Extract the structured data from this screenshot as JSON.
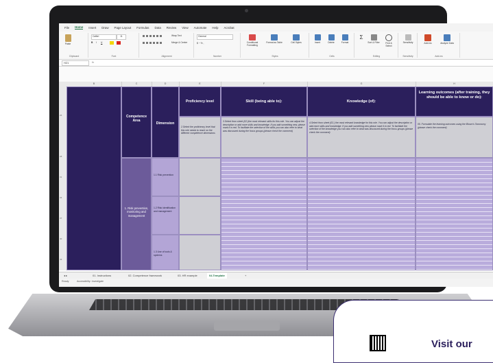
{
  "menu": [
    "File",
    "Home",
    "Insert",
    "Draw",
    "Page Layout",
    "Formulas",
    "Data",
    "Review",
    "View",
    "Automate",
    "Help",
    "Acrobat"
  ],
  "active_menu": "Home",
  "ribbon": {
    "clipboard": {
      "paste": "Paste",
      "label": "Clipboard"
    },
    "font": {
      "name": "Calibri",
      "size": "11",
      "label": "Font"
    },
    "alignment": {
      "wrap": "Wrap Text",
      "merge": "Merge & Center",
      "label": "Alignment"
    },
    "number": {
      "format": "General",
      "label": "Number"
    },
    "styles": {
      "conditional": "Conditional Formatting",
      "format_table": "Format as Table",
      "cell_styles": "Cell Styles",
      "label": "Styles"
    },
    "cells": {
      "insert": "Insert",
      "delete": "Delete",
      "format": "Format",
      "label": "Cells"
    },
    "editing": {
      "sort": "Sort & Filter",
      "find": "Find & Select",
      "label": "Editing"
    },
    "sensitivity": {
      "label": "Sensitivity"
    },
    "addins": {
      "addins": "Add-ins",
      "analyze": "Analyze Data",
      "label": "Add-ins"
    }
  },
  "formula_bar": {
    "name_box": "H21",
    "fx": "fx"
  },
  "columns": [
    "B",
    "C",
    "D",
    "E",
    "F",
    "G",
    "H"
  ],
  "headers": {
    "competence_area": "Competence Area",
    "dimension": "Dimension",
    "proficiency": "Proficiency level",
    "skill": "Skill (being able to):",
    "knowledge": "Knowledge (of):",
    "learning": "Learning outcomes (after training, they should be able to know or do):"
  },
  "notes": {
    "proficiency": "2.Select the proficiency level that this role needs to reach on the different competence dimensions",
    "skill": "3.Select from sheet (02.)the most relevant skills for this role. You can adjust the description or add more skills and knowledge. If you add something new, please mark it in red. To facilitate the selection of the skills you can also refer to what was discussed during the focus groups (please check the comment)",
    "knowledge": "4.Select from sheet (02.) the most relevant knowledge for this role. You can adjust the description or add more skills and knowledge. If you add something new please mark it in red. To facilitate the selection of the knowledge you can also refer to what was discussed during the focus groups (please check the comment)",
    "learning": "05. Formulate the learning outcomes using the Bloom's Taxonomy (please check the comment)"
  },
  "competence_area": "1. Risk prevention, monitoring and management",
  "dimensions": [
    "1.1 Risk prevention",
    "1.2 Risk identification and management",
    "1.3 Use of tools & systems"
  ],
  "tabs": [
    "01. Instructions",
    "02. Competence framework",
    "03. HR example",
    "04.Template"
  ],
  "active_tab": "04.Template",
  "status": {
    "ready": "Ready",
    "accessibility": "Accessibility: Investigate"
  },
  "promo": {
    "text": "Visit our"
  }
}
